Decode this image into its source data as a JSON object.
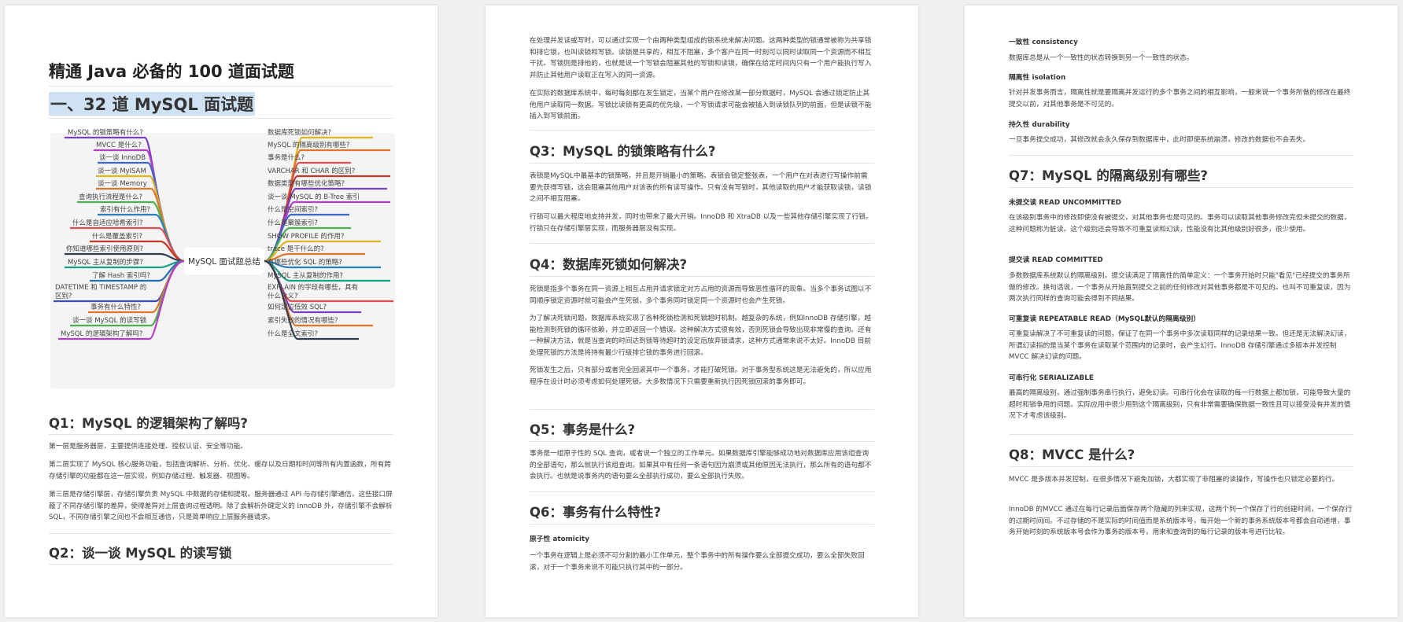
{
  "page1": {
    "doc_title": "精通 Java 必备的 100 道面试题",
    "section_title": "一、32 道 MySQL 面试题",
    "mindmap": {
      "center": "MySQL 面试题总结",
      "left": [
        "MySQL 的锁策略有什么?",
        "MVCC 是什么?",
        "谈一谈 InnoDB",
        "谈一谈 MyISAM",
        "谈一谈 Memory",
        "查询执行流程是什么?",
        "索引有什么作用?",
        "什么是自适应哈希索引?",
        "什么是覆盖索引?",
        "你知道哪些索引使用原则?",
        "MySQL 主从复制的步骤?",
        "了解 Hash 索引吗?",
        "DATETIME 和 TIMESTAMP 的",
        "区别?",
        "事务有什么特性?",
        "谈一谈 MySQL 的读写锁",
        "MySQL 的逻辑架构了解吗?"
      ],
      "right": [
        "数据库死锁如何解决?",
        "MySQL 的隔离级别有哪些?",
        "事务是什么?",
        "VARCHAR 和 CHAR 的区别?",
        "数据类型有哪些优化策略?",
        "谈一谈 MySQL 的 B-Tree 索引",
        "什么是空间索引?",
        "什么是聚簇索引?",
        "SHOW PROFILE 的作用?",
        "trace 是干什么的?",
        "有哪些优化 SQL 的策略?",
        "MySQL 主从复制的作用?",
        "EXPLAIN 的字段有哪些，具有",
        "什么含义?",
        "如何定位低效 SQL?",
        "索引失效的情况有哪些?",
        "什么是全文索引?"
      ]
    },
    "q1": {
      "title": "Q1：MySQL 的逻辑架构了解吗?",
      "p1": "第一层是服务器层，主要提供连接处理、授权认证、安全等功能。",
      "p2": "第二层实现了 MySQL 核心服务功能，包括查询解析、分析、优化、缓存以及日期和时间等所有内置函数，所有跨存储引擎的功能都在这一层实现，例如存储过程、触发器、视图等。",
      "p3": "第三层是存储引擎层，存储引擎负责 MySQL 中数据的存储和提取。服务器通过 API 与存储引擎通信，这些接口屏蔽了不同存储引擎的差异，使得差异对上层查询过程透明。除了会解析外键定义的 InnoDB 外，存储引擎不会解析 SQL，不同存储引擎之间也不会相互通信，只是简单响应上层服务器请求。"
    },
    "q2": {
      "title": "Q2：谈一谈 MySQL 的读写锁"
    }
  },
  "page2": {
    "p1": "在处理并发读或写时，可以通过实现一个由两种类型组成的锁系统来解决问题。这两种类型的锁通常被称为共享锁和排它锁，也叫读锁和写锁。读锁是共享的，相互不阻塞，多个客户在同一时刻可以同时读取同一个资源而不相互干扰。写锁则是排他的，也就是说一个写锁会阻塞其他的写锁和读锁，确保在给定时间内只有一个用户能执行写入并防止其他用户读取正在写入的同一资源。",
    "p2": "在实际的数据库系统中，每时每刻都在发生锁定，当某个用户在修改某一部分数据时，MySQL 会通过锁定防止其他用户读取同一数据。写锁比读锁有更高的优先级，一个写锁请求可能会被插入到读锁队列的前面，但是读锁不能插入到写锁前面。",
    "q3": {
      "title": "Q3：MySQL 的锁策略有什么?",
      "p1": "表锁是MySQL中最基本的锁策略，并且是开销最小的策略。表锁会锁定整张表，一个用户在对表进行写操作前需要先获得写锁，这会阻塞其他用户对该表的所有读写操作。只有没有写锁时，其他读取的用户才能获取读锁，读锁之间不相互阻塞。",
      "p2": "行锁可以最大程度地支持并发，同时也带来了最大开销。InnoDB 和 XtraDB 以及一些其他存储引擎实现了行锁。行锁只在存储引擎层实现，而服务器层没有实现。"
    },
    "q4": {
      "title": "Q4：数据库死锁如何解决?",
      "p1": "死锁是指多个事务在同一资源上相互占用并请求锁定对方占用的资源而导致恶性循环的现象。当多个事务试图以不同顺序锁定资源时就可能会产生死锁，多个事务同时锁定同一个资源时也会产生死锁。",
      "p2": "为了解决死锁问题，数据库系统实现了各种死锁检测和死锁超时机制。越复杂的系统，例如InnoDB 存储引擎，越能检测到死锁的循环依赖，并立即返回一个错误。这种解决方式很有效，否则死锁会导致出现非常慢的查询。还有一种解决方法，就是当查询的时间达到锁等待超时的设定后放弃锁请求，这种方式通常来说不太好。InnoDB 目前处理死锁的方法是将持有最少行级排它锁的事务进行回滚。",
      "p3": "死锁发生之后，只有部分或者完全回滚其中一个事务，才能打破死锁。对于事务型系统这是无法避免的，所以应用程序在设计时必须考虑如何处理死锁。大多数情况下只需要重新执行因死锁回滚的事务即可。"
    },
    "q5": {
      "title": "Q5：事务是什么?",
      "p1": "事务是一组原子性的 SQL 查询，或者说一个独立的工作单元。如果数据库引擎能够成功地对数据库应用该组查询的全部语句，那么就执行该组查询。如果其中有任何一条语句因为崩溃或其他原因无法执行，那么所有的语句都不会执行。也就是说事务内的语句要么全部执行成功，要么全部执行失败。"
    },
    "q6": {
      "title": "Q6：事务有什么特性?",
      "sub1": "原子性 atomicity",
      "p1": "一个事务在逻辑上是必须不可分割的最小工作单元，整个事务中的所有操作要么全部提交成功，要么全部失败回滚，对于一个事务来说不可能只执行其中的一部分。"
    }
  },
  "page3": {
    "sub1": "一致性 consistency",
    "p1": "数据库总是从一个一致性的状态转换到另一个一致性的状态。",
    "sub2": "隔离性 isolation",
    "p2": "针对并发事务而言，隔离性就是要隔离并发运行的多个事务之间的相互影响，一般来说一个事务所做的修改在最终提交以前，对其他事务是不可见的。",
    "sub3": "持久性 durability",
    "p3": "一旦事务提交成功，其修改就会永久保存到数据库中，此时即使系统崩溃，修改的数据也不会丢失。",
    "q7": {
      "title": "Q7：MySQL 的隔离级别有哪些?",
      "sub1": "未提交读 READ UNCOMMITTED",
      "p1": "在该级别事务中的修改即使没有被提交，对其他事务也是可见的。事务可以读取其他事务修改完但未提交的数据，这种问题称为脏读。这个级别还会导致不可重复读和幻读，性能没有比其他级别好很多，很少使用。",
      "sub2": "提交读 READ COMMITTED",
      "p2": "多数数据库系统默认的隔离级别。提交读满足了隔离性的简单定义：一个事务开始时只能\"看见\"已经提交的事务所做的修改。换句话说，一个事务从开始直到提交之前的任何修改对其他事务都是不可见的。也叫不可重复读，因为两次执行同样的查询可能会得到不同结果。",
      "sub3": "可重复读 REPEATABLE READ（MySQL默认的隔离级别）",
      "p3": "可重复读解决了不可重复读的问题，保证了在同一个事务中多次读取同样的记录结果一致。但还是无法解决幻读，所谓幻读指的是当某个事务在读取某个范围内的记录时，会产生幻行。InnoDB 存储引擎通过多版本并发控制MVCC 解决幻读的问题。",
      "sub4": "可串行化 SERIALIZABLE",
      "p4": "最高的隔离级别，通过强制事务串行执行，避免幻读。可串行化会在读取的每一行数据上都加锁，可能导致大量的超时和锁争用的问题。实际应用中很少用到这个隔离级别，只有非常需要确保数据一致性且可以接受没有并发的情况下才考虑该级别。"
    },
    "q8": {
      "title": "Q8：MVCC 是什么?",
      "p1": "MVCC 是多版本并发控制，在很多情况下避免加锁，大都实现了非阻塞的读操作，写操作也只锁定必要的行。",
      "p2": "InnoDB 的MVCC 通过在每行记录后面保存两个隐藏的列来实现，这两个列一个保存了行的创建时间，一个保存行的过期时间间。不过存储的不是实际的时间值而是系统版本号，每开始一个新的事务系统版本号都会自动递增，事务开始时刻的系统版本号会作为事务的版本号，用来和查询到的每行记录的版本号进行比较。"
    }
  }
}
